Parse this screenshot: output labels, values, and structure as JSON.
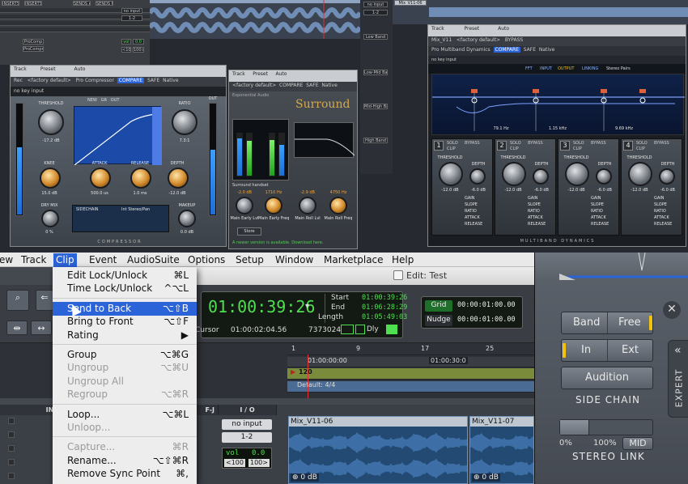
{
  "collage": {
    "mixer_top": {
      "headers": [
        "INSERTS A-E",
        "INSERTS F-J",
        "SENDS A-E",
        "SENDS F-J"
      ],
      "track_names": [
        "ProComp",
        "ProCompr"
      ],
      "io_labels": [
        "no input",
        "1-2",
        "vol",
        "0.0",
        "<100",
        "100>"
      ]
    },
    "track_labels": [
      "Mix_V11-06",
      "Low Band",
      "Low-Mid Band",
      "Mid-High Band",
      "High Band"
    ],
    "compressor": {
      "header": {
        "track": "Track",
        "preset": "Preset",
        "auto": "Auto",
        "track_value": "Rec",
        "preset_value": "<factory default>",
        "plugin": "Pro Compressor",
        "compare": "COMPARE",
        "safe": "SAFE",
        "native": "Native",
        "key_input": "no key input"
      },
      "knob_labels": [
        "THRESHOLD",
        "RATIO",
        "KNEE",
        "ATTACK",
        "RELEASE",
        "DEPTH",
        "DRY MIX",
        "MAKEUP"
      ],
      "values": [
        "-17.2 dB",
        "7.3:1",
        "15.0 dB",
        "500.0 us",
        "1.0 ms",
        "-12.0 dB",
        "0 %",
        "0.0 dB"
      ],
      "meter_label": "OUT",
      "buttons": [
        "NEW",
        "GR",
        "OUT",
        "SIDECHAIN",
        "Int Stereo/Pan"
      ],
      "brand": "COMPRESSOR"
    },
    "surround": {
      "header": {
        "track": "Track",
        "preset": "Preset",
        "auto": "Auto",
        "preset_value": "<factory default>",
        "plugin": "Surround",
        "compare": "COMPARE",
        "safe": "SAFE",
        "native": "Native"
      },
      "brand": "Surround",
      "maker": "Exponential Audio",
      "section": "Surround handset",
      "knob_values": [
        "-2.0 dB",
        "1710 Hz",
        "-2.9 dB",
        "4750 Hz"
      ],
      "knob_labels": [
        "Main Early Lvl",
        "Main Early Freq",
        "Main Roll Lvl",
        "Main Roll Freq"
      ],
      "update_notice": "A newer version is available. Download here.",
      "store_label": "Store"
    },
    "multiband": {
      "header": {
        "track": "Track",
        "preset": "Preset",
        "auto": "Auto",
        "track_value": "Mix_V11",
        "preset_value": "<factory default>",
        "plugin": "Pro Multiband Dynamics",
        "compare": "COMPARE",
        "safe": "SAFE",
        "native": "Native",
        "bypass": "BYPASS",
        "key_input": "no key input"
      },
      "tabs": [
        "FFT",
        "INPUT",
        "OUTPUT"
      ],
      "link_label": "LINKING",
      "stereo_label": "Stereo Pairs",
      "band_nums": [
        "1",
        "2",
        "3",
        "4"
      ],
      "buttons": [
        "SOLO",
        "BYPASS",
        "CLIP"
      ],
      "knob_labels": [
        "THRESHOLD",
        "DEPTH"
      ],
      "knob_values": [
        "-12.0 dB",
        "-6.0 dB"
      ],
      "params": [
        "GAIN",
        "SLOPE",
        "RATIO",
        "ATTACK",
        "RELEASE"
      ],
      "freqs": [
        "79.1 Hz",
        "1.15 kHz",
        "9.69 kHz"
      ],
      "brand": "MULTIBAND DYNAMICS"
    }
  },
  "menubar": {
    "items": [
      "ew",
      "Track",
      "Clip",
      "Event",
      "AudioSuite",
      "Options",
      "Setup",
      "Window",
      "Marketplace",
      "Help"
    ],
    "active": "Clip"
  },
  "clip_menu": [
    {
      "label": "Edit Lock/Unlock",
      "shortcut": "⌘L",
      "enabled": true
    },
    {
      "label": "Time Lock/Unlock",
      "shortcut": "^⌥L",
      "enabled": true
    },
    {
      "label": "Send to Back",
      "shortcut": "⌥⇧B",
      "enabled": true,
      "highlighted": true
    },
    {
      "label": "Bring to Front",
      "shortcut": "⌥⇧F",
      "enabled": true
    },
    {
      "label": "Rating",
      "shortcut": "▶",
      "enabled": true
    },
    {
      "label": "Group",
      "shortcut": "⌥⌘G",
      "enabled": true
    },
    {
      "label": "Ungroup",
      "shortcut": "⌥⌘U",
      "enabled": false
    },
    {
      "label": "Ungroup All",
      "shortcut": "",
      "enabled": false
    },
    {
      "label": "Regroup",
      "shortcut": "⌥⌘R",
      "enabled": false
    },
    {
      "label": "Loop...",
      "shortcut": "⌥⌘L",
      "enabled": true
    },
    {
      "label": "Unloop...",
      "shortcut": "",
      "enabled": false
    },
    {
      "label": "Capture...",
      "shortcut": "⌘R",
      "enabled": false
    },
    {
      "label": "Rename...",
      "shortcut": "⌥⇧⌘R",
      "enabled": true
    },
    {
      "label": "Remove Sync Point",
      "shortcut": "⌘,",
      "enabled": true
    }
  ],
  "edit_window": {
    "title": "Edit: Test",
    "main_counter": "01:00:39:26",
    "sub_counter_label": "Cursor",
    "sub_counter": "01:00:02:04.56",
    "sample_value": "7373024",
    "dly_label": "Dly",
    "start_label": "Start",
    "end_label": "End",
    "length_label": "Length",
    "start": "01:00:39:26",
    "end": "01:06:28:29",
    "length": "01:05:49:03",
    "grid_label": "Grid",
    "grid_value": "00:00:01:00.00",
    "nudge_label": "Nudge",
    "nudge_value": "00:00:01:00.00"
  },
  "timeline": {
    "bars": [
      "1",
      "9",
      "17",
      "25"
    ],
    "timecode_start": "01:00:00:00",
    "timecode_marker": "01:00:30:0",
    "tempo": "120",
    "meter": "Default: 4/4"
  },
  "track_area": {
    "headers": [
      "INSERTS A-E",
      "F-J",
      "I / O"
    ],
    "io_input": "no input",
    "io_output": "1-2",
    "vol_label": "vol",
    "vol_value": "0.0",
    "pan_left": "<100",
    "pan_right": "100>",
    "clips": [
      {
        "name": "Mix_V11-06",
        "gain": "0 dB"
      },
      {
        "name": "Mix_V11-07",
        "gain": "0 dB"
      }
    ]
  },
  "sidechain_panel": {
    "band_label": "Band",
    "free_label": "Free",
    "in_label": "In",
    "ext_label": "Ext",
    "audition_label": "Audition",
    "section_label": "SIDE CHAIN",
    "link_min": "0%",
    "link_max": "100%",
    "mid_label": "MID",
    "link_label": "STEREO LINK",
    "expert_label": "EXPERT",
    "stereo_link_fraction": 0.32
  },
  "colors": {
    "accent_blue": "#2b63d8",
    "highlight_yellow": "#f3c20b",
    "counter_green": "#4fe04f",
    "clip_blue": "#234a73"
  }
}
